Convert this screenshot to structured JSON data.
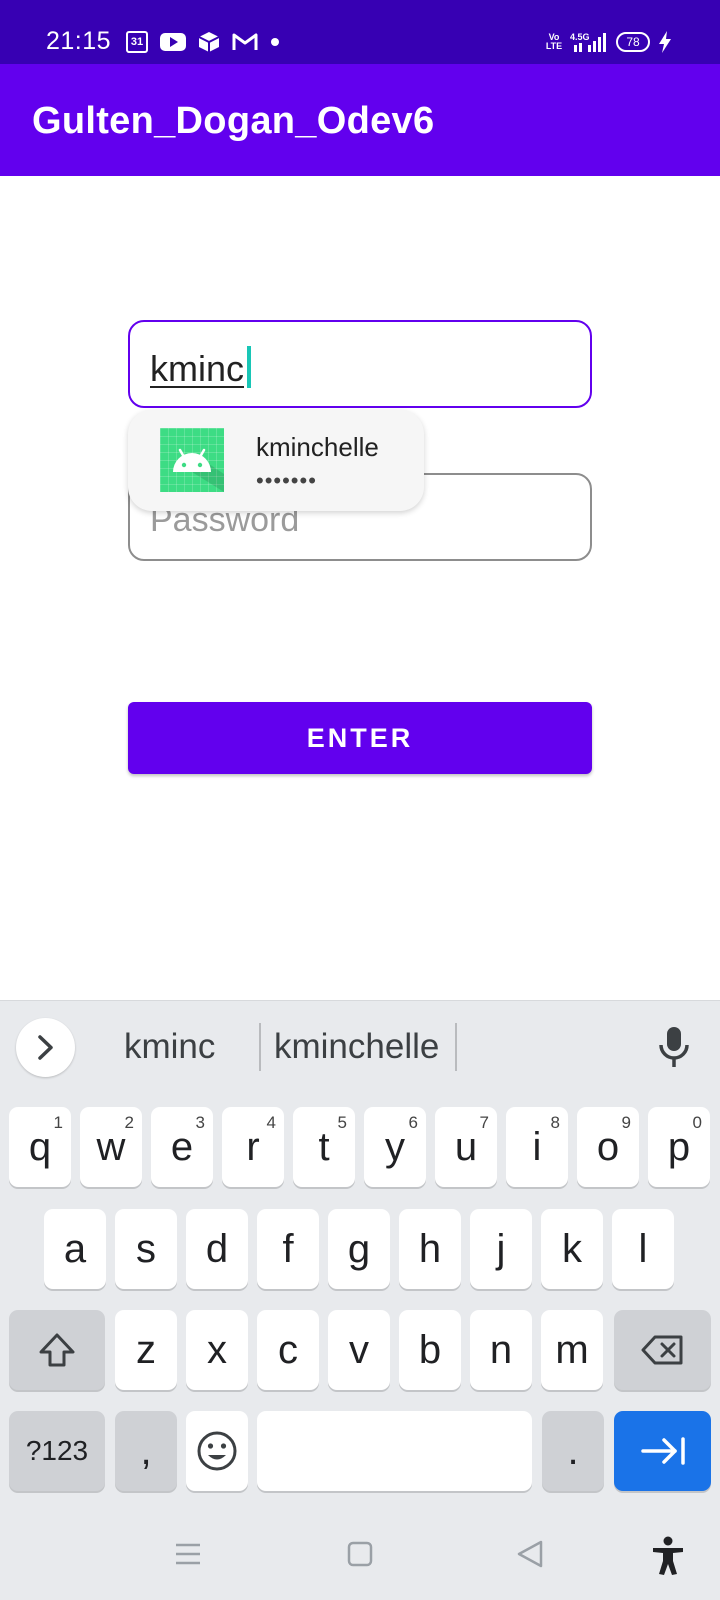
{
  "status_bar": {
    "time": "21:15",
    "calendar_date": "31",
    "battery": "78",
    "icons": [
      "calendar-icon",
      "youtube-icon",
      "box-icon",
      "gmail-icon",
      "dot-icon",
      "volte-icon",
      "signal-icon",
      "battery-icon",
      "charging-icon"
    ],
    "volte_label": "Vo LTE",
    "network_label": "4.5G"
  },
  "app_bar": {
    "title": "Gulten_Dogan_Odev6"
  },
  "form": {
    "username_value": "kminc",
    "password_placeholder": "Password",
    "enter_label": "ENTER"
  },
  "autofill": {
    "username": "kminchelle",
    "password_mask": "•••••••"
  },
  "keyboard": {
    "suggestions": [
      "kminc",
      "kminchelle"
    ],
    "row1": [
      {
        "key": "q",
        "hint": "1"
      },
      {
        "key": "w",
        "hint": "2"
      },
      {
        "key": "e",
        "hint": "3"
      },
      {
        "key": "r",
        "hint": "4"
      },
      {
        "key": "t",
        "hint": "5"
      },
      {
        "key": "y",
        "hint": "6"
      },
      {
        "key": "u",
        "hint": "7"
      },
      {
        "key": "i",
        "hint": "8"
      },
      {
        "key": "o",
        "hint": "9"
      },
      {
        "key": "p",
        "hint": "0"
      }
    ],
    "row2": [
      "a",
      "s",
      "d",
      "f",
      "g",
      "h",
      "j",
      "k",
      "l"
    ],
    "row3": [
      "z",
      "x",
      "c",
      "v",
      "b",
      "n",
      "m"
    ],
    "symbols_label": "?123",
    "comma_label": ",",
    "period_label": "."
  },
  "colors": {
    "status_bar": "#3700b3",
    "primary": "#6200ee",
    "cursor": "#18c6b6",
    "keyboard_action": "#1a73e8"
  }
}
